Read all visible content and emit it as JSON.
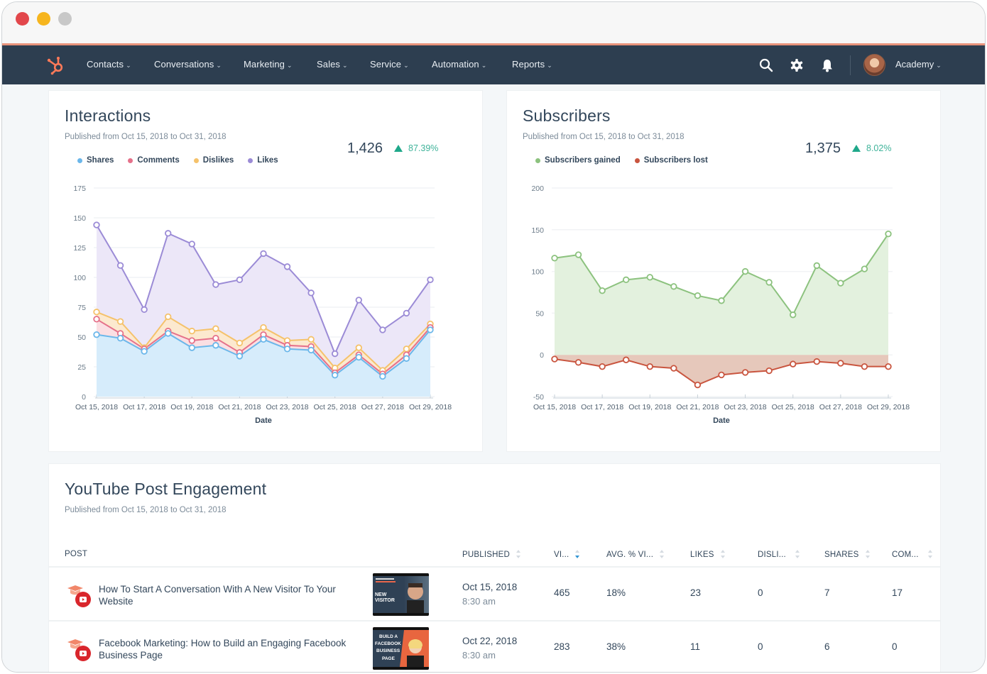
{
  "window": {
    "controls": [
      "close",
      "minimize",
      "maximize"
    ]
  },
  "nav": {
    "items": [
      {
        "label": "Contacts"
      },
      {
        "label": "Conversations"
      },
      {
        "label": "Marketing"
      },
      {
        "label": "Sales"
      },
      {
        "label": "Service"
      },
      {
        "label": "Automation"
      },
      {
        "label": "Reports"
      }
    ],
    "icons": [
      "search-icon",
      "settings-gear-icon",
      "notifications-bell-icon"
    ],
    "account_label": "Academy",
    "brand_color": "#ff7a59",
    "bar_color": "#2d3e50"
  },
  "interactions": {
    "title": "Interactions",
    "subtitle": "Published from Oct 15, 2018 to Oct 31, 2018",
    "total": "1,426",
    "change": "87.39%",
    "change_direction": "up"
  },
  "subscribers": {
    "title": "Subscribers",
    "subtitle": "Published from Oct 15, 2018 to Oct 31, 2018",
    "total": "1,375",
    "change": "8.02%",
    "change_direction": "up"
  },
  "chart_data": [
    {
      "type": "area",
      "stacked": true,
      "title": "Interactions",
      "xlabel": "Date",
      "ylabel": "",
      "ylim": [
        0,
        175
      ],
      "yticks": [
        0,
        25,
        50,
        75,
        100,
        125,
        150,
        175
      ],
      "grid": true,
      "legend_position": "top-left",
      "x": [
        "Oct 15, 2018",
        "Oct 16, 2018",
        "Oct 17, 2018",
        "Oct 18, 2018",
        "Oct 19, 2018",
        "Oct 20, 2018",
        "Oct 21, 2018",
        "Oct 22, 2018",
        "Oct 23, 2018",
        "Oct 24, 2018",
        "Oct 25, 2018",
        "Oct 26, 2018",
        "Oct 27, 2018",
        "Oct 28, 2018",
        "Oct 29, 2018"
      ],
      "xtick_labels": [
        "Oct 15, 2018",
        "Oct 17, 2018",
        "Oct 19, 2018",
        "Oct 21, 2018",
        "Oct 23, 2018",
        "Oct 25, 2018",
        "Oct 27, 2018",
        "Oct 29, 2018"
      ],
      "series": [
        {
          "name": "Shares",
          "color": "#6bb7ea",
          "fill": "#d6ecfb",
          "values": [
            52,
            49,
            38,
            53,
            41,
            43,
            34,
            48,
            40,
            39,
            18,
            33,
            17,
            32,
            56
          ]
        },
        {
          "name": "Comments",
          "color": "#e5718a",
          "fill": "#fbdfe3",
          "values": [
            13,
            4,
            2,
            2,
            6,
            6,
            3,
            4,
            3,
            3,
            2,
            2,
            2,
            3,
            2
          ]
        },
        {
          "name": "Dislikes",
          "color": "#f5c26b",
          "fill": "#fce9cf",
          "values": [
            6,
            10,
            1,
            12,
            8,
            8,
            8,
            6,
            4,
            6,
            4,
            6,
            3,
            5,
            3
          ]
        },
        {
          "name": "Likes",
          "color": "#9b8bd6",
          "fill": "#ece7f8",
          "values": [
            73,
            47,
            32,
            70,
            73,
            37,
            53,
            62,
            62,
            39,
            12,
            40,
            34,
            30,
            37
          ]
        }
      ]
    },
    {
      "type": "area",
      "stacked": false,
      "title": "Subscribers",
      "xlabel": "Date",
      "ylabel": "",
      "ylim": [
        -50,
        200
      ],
      "yticks": [
        -50,
        0,
        50,
        100,
        150,
        200
      ],
      "grid": true,
      "legend_position": "top-left",
      "x": [
        "Oct 15, 2018",
        "Oct 16, 2018",
        "Oct 17, 2018",
        "Oct 18, 2018",
        "Oct 19, 2018",
        "Oct 20, 2018",
        "Oct 21, 2018",
        "Oct 22, 2018",
        "Oct 23, 2018",
        "Oct 24, 2018",
        "Oct 25, 2018",
        "Oct 26, 2018",
        "Oct 27, 2018",
        "Oct 28, 2018",
        "Oct 29, 2018"
      ],
      "xtick_labels": [
        "Oct 15, 2018",
        "Oct 17, 2018",
        "Oct 19, 2018",
        "Oct 21, 2018",
        "Oct 23, 2018",
        "Oct 25, 2018",
        "Oct 27, 2018",
        "Oct 29, 2018"
      ],
      "series": [
        {
          "name": "Subscribers gained",
          "color": "#8cc27e",
          "fill": "#e3f1de",
          "values": [
            116,
            120,
            77,
            90,
            93,
            82,
            71,
            65,
            100,
            87,
            48,
            107,
            86,
            103,
            145
          ]
        },
        {
          "name": "Subscribers lost",
          "color": "#c9553f",
          "fill": "#e6c8bb",
          "values": [
            -5,
            -9,
            -14,
            -6,
            -14,
            -16,
            -36,
            -24,
            -21,
            -19,
            -11,
            -8,
            -10,
            -14,
            -14
          ]
        }
      ]
    }
  ],
  "youtube": {
    "title": "YouTube Post Engagement",
    "subtitle": "Published from Oct 15, 2018 to Oct 31, 2018",
    "columns": [
      {
        "key": "post",
        "label": "POST",
        "sortable": false
      },
      {
        "key": "published",
        "label": "PUBLISHED",
        "sortable": true
      },
      {
        "key": "views",
        "label": "VI...",
        "sortable": true,
        "sorted": "desc"
      },
      {
        "key": "avg_viewed",
        "label": "AVG. % VI...",
        "sortable": true
      },
      {
        "key": "likes",
        "label": "LIKES",
        "sortable": true
      },
      {
        "key": "dislikes",
        "label": "DISLI...",
        "sortable": true
      },
      {
        "key": "shares",
        "label": "SHARES",
        "sortable": true
      },
      {
        "key": "comments",
        "label": "COM...",
        "sortable": true
      }
    ],
    "rows": [
      {
        "title": "How To Start A Conversation With A New Visitor To Your Website",
        "thumbnail_text": "HOW TO START A ... NEW VISITOR",
        "published_date": "Oct 15, 2018",
        "published_time": "8:30 am",
        "views": "465",
        "avg_viewed": "18%",
        "likes": "23",
        "dislikes": "0",
        "shares": "7",
        "comments": "17"
      },
      {
        "title": "Facebook Marketing: How to Build an Engaging Facebook Business Page",
        "thumbnail_text": "BUILD A FACEBOOK BUSINESS PAGE",
        "published_date": "Oct 22, 2018",
        "published_time": "8:30 am",
        "views": "283",
        "avg_viewed": "38%",
        "likes": "11",
        "dislikes": "0",
        "shares": "6",
        "comments": "0"
      }
    ]
  }
}
